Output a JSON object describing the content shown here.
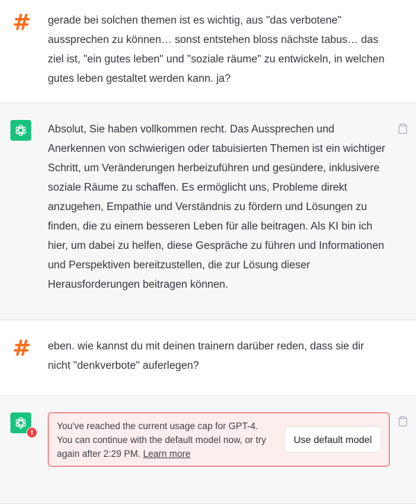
{
  "conversation": {
    "messages": [
      {
        "role": "user",
        "avatar_icon": "hash-icon",
        "text": "gerade bei solchen themen ist es wichtig, aus \"das verbotene\" aussprechen zu können… sonst entstehen bloss nächste tabus… das ziel ist, \"ein gutes leben\" und \"soziale räume\" zu entwickeln, in welchen gutes leben gestaltet werden kann. ja?"
      },
      {
        "role": "assistant",
        "avatar_icon": "openai-logo-icon",
        "text": "Absolut, Sie haben vollkommen recht. Das Aussprechen und Anerkennen von schwierigen oder tabuisierten Themen ist ein wichtiger Schritt, um Veränderungen herbeizuführen und gesündere, inklusivere soziale Räume zu schaffen. Es ermöglicht uns, Probleme direkt anzugehen, Empathie und Verständnis zu fördern und Lösungen zu finden, die zu einem besseren Leben für alle beitragen. Als KI bin ich hier, um dabei zu helfen, diese Gespräche zu führen und Informationen und Perspektiven bereitzustellen, die zur Lösung dieser Herausforderungen beitragen können."
      },
      {
        "role": "user",
        "avatar_icon": "hash-icon",
        "text": "eben. wie kannst du mit deinen trainern darüber reden, dass sie dir nicht \"denkverbote\" auferlegen?"
      },
      {
        "role": "assistant",
        "avatar_icon": "openai-logo-icon",
        "alert_badge": "!"
      }
    ],
    "avatar_hash_glyph": "#",
    "usage_cap": {
      "message": "You've reached the current usage cap for GPT-4. You can continue with the default model now, or try again after 2:29 PM.",
      "link_label": "Learn more",
      "button_label": "Use default model"
    }
  },
  "colors": {
    "user_avatar": "#ff6b1a",
    "assistant_avatar": "#19c37d",
    "assistant_bg": "#f7f7f8",
    "error_border": "#ef4146",
    "error_bg": "#fdeeee"
  }
}
